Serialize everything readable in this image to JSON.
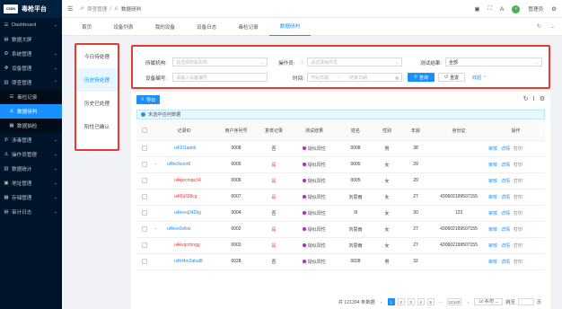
{
  "app": {
    "logo_text": "CSDN",
    "title": "毒枪平台"
  },
  "sidebar": {
    "items": [
      {
        "icon": "☰",
        "label": "Dashboard",
        "arrow": "⌄"
      },
      {
        "icon": "▤",
        "label": "数据大屏",
        "arrow": ""
      },
      {
        "icon": "⚙",
        "label": "系统管理",
        "arrow": "⌄"
      },
      {
        "icon": "✥",
        "label": "设备管理",
        "arrow": "⌄"
      },
      {
        "icon": "▥",
        "label": "筛查管理",
        "arrow": "⌃"
      },
      {
        "icon": "☰",
        "label": "毒检记录",
        "arrow": "",
        "sub": true
      },
      {
        "icon": "♙",
        "label": "数据研判",
        "arrow": "",
        "sub": true,
        "active": true
      },
      {
        "icon": "▦",
        "label": "数据抽检",
        "arrow": "",
        "sub": true
      },
      {
        "icon": "✆",
        "label": "涉毒管理",
        "arrow": "⌄"
      },
      {
        "icon": "♙",
        "label": "操作员管理",
        "arrow": "⌄"
      },
      {
        "icon": "▥",
        "label": "数据统计",
        "arrow": "⌄"
      },
      {
        "icon": "▣",
        "label": "地址管理",
        "arrow": "⌄"
      },
      {
        "icon": "▦",
        "label": "存储管理",
        "arrow": "⌄"
      },
      {
        "icon": "▤",
        "label": "审计日志",
        "arrow": "⌄"
      }
    ]
  },
  "header": {
    "breadcrumb": [
      "筛查管理",
      "数据研判"
    ],
    "user": "管理员",
    "lang": "A"
  },
  "tabs": [
    "首页",
    "设备列表",
    "我的设备",
    "设备日志",
    "毒检记录",
    "数据研判"
  ],
  "left_panel": {
    "items": [
      "今日待处理",
      "历史待处理",
      "历史已处理",
      "阳性已确认"
    ]
  },
  "filter": {
    "org_label": "所属机构:",
    "org_placeholder": "请选择所属机构",
    "operator_label": "操作员:",
    "operator_placeholder": "请选择操作员",
    "result_label": "测试结果:",
    "result_value": "全部",
    "device_label": "设备编号:",
    "device_placeholder": "请输入设备编号",
    "time_label": "时间:",
    "start_placeholder": "开始日期",
    "range_sep": "→",
    "end_placeholder": "结束日期",
    "query_button": "查询",
    "reset_button": "重置",
    "collapse_link": "收起 ⌃"
  },
  "toolbar": {
    "export_button": "导出"
  },
  "notice": "未选中任何数据",
  "table": {
    "columns": [
      "记录ID",
      "用户序列号",
      "复核记录",
      "测试结果",
      "姓名",
      "性别",
      "年龄",
      "身份证",
      "操作"
    ],
    "rows": [
      {
        "expand": "",
        "id": "u4l2t1aebk",
        "serial": "0008",
        "review": "否",
        "result": "疑似阳性",
        "name": "0008",
        "gender": "男",
        "age": "38",
        "idcard": "",
        "review_red": false,
        "id_red": false
      },
      {
        "expand": "−",
        "id": "u4be9ssnr8",
        "serial": "0005",
        "review": "是",
        "result": "疑似阳性",
        "name": "0005",
        "gender": "女",
        "age": "29",
        "idcard": "",
        "review_red": true,
        "id_red": false
      },
      {
        "expand": "",
        "id": "u4kjecmqe34",
        "serial": "0006",
        "review": "是",
        "result": "疑似阳性",
        "name": "0005",
        "gender": "女",
        "age": "29",
        "idcard": "",
        "review_red": true,
        "id_red": true
      },
      {
        "expand": "",
        "id": "u4l0jt338cg",
        "serial": "0007",
        "review": "是",
        "result": "疑似阳性",
        "name": "刘思雨",
        "gender": "女",
        "age": "27",
        "idcard": "430602199507155",
        "review_red": true,
        "id_red": true
      },
      {
        "expand": "",
        "id": "u4kvoq242kg",
        "serial": "0004",
        "review": "否",
        "result": "疑似阳性",
        "name": "Ill",
        "gender": "女",
        "age": "30",
        "idcard": "123",
        "review_red": false,
        "id_red": false
      },
      {
        "expand": "−",
        "id": "u4koe0sfsw",
        "serial": "0002",
        "review": "是",
        "result": "疑似阳性",
        "name": "刘思雨",
        "gender": "女",
        "age": "27",
        "idcard": "430602199507155",
        "review_red": true,
        "id_red": false
      },
      {
        "expand": "",
        "id": "u4kvqrzhngg",
        "serial": "0003",
        "review": "是",
        "result": "疑似阳性",
        "name": "刘思雨",
        "gender": "女",
        "age": "27",
        "idcard": "430602199507155",
        "review_red": true,
        "id_red": true
      },
      {
        "expand": "",
        "id": "u4hf4m2ahal8",
        "serial": "0028",
        "review": "否",
        "result": "疑似阳性",
        "name": "0028",
        "gender": "男",
        "age": "32",
        "idcard": "",
        "review_red": false,
        "id_red": false
      }
    ],
    "ops": [
      "审核",
      "详情",
      "打印"
    ]
  },
  "pager": {
    "total": "共 121394 条数据",
    "pages": [
      "1",
      "2",
      "3",
      "4",
      "5",
      "···",
      "12140"
    ],
    "per_page": "10 条/页",
    "jump_label": "跳至",
    "page_suffix": "页"
  },
  "colors": {
    "primary": "#1890ff",
    "sidebar": "#001529",
    "highlight": "#e53935"
  }
}
